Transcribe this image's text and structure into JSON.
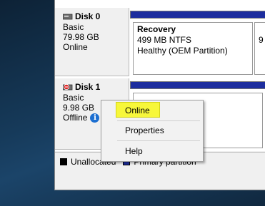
{
  "disks": [
    {
      "name": "Disk 0",
      "type": "Basic",
      "size": "79.98 GB",
      "status": "Online"
    },
    {
      "name": "Disk 1",
      "type": "Basic",
      "size": "9.98 GB",
      "status": "Offline"
    }
  ],
  "partitions": {
    "recovery": {
      "title": "Recovery",
      "size_fs": "499 MB NTFS",
      "health": "Healthy (OEM Partition)"
    },
    "partial_marker": "9"
  },
  "context_menu": {
    "items": [
      "Online",
      "Properties",
      "Help"
    ],
    "highlighted": "Online"
  },
  "legend": {
    "unallocated": "Unallocated",
    "primary": "Primary partition"
  },
  "colors": {
    "primary_partition": "#1d2d9e",
    "unallocated": "#000000",
    "highlight": "#f7f73a",
    "info_icon": "#1c6fd1"
  },
  "icons": [
    "disk-icon",
    "disk-offline-icon",
    "info-icon"
  ]
}
